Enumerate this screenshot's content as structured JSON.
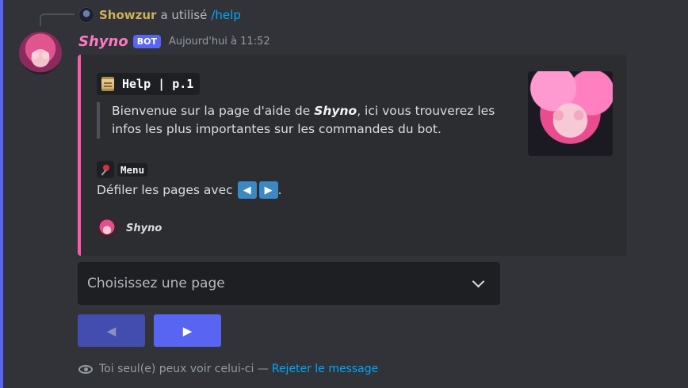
{
  "reply": {
    "username": "Showzur",
    "text": "a utilisé",
    "command": "/help"
  },
  "message": {
    "author": "Shyno",
    "bot_tag": "BOT",
    "timestamp": "Aujourd'hui à 11:52"
  },
  "embed": {
    "accent_color": "#ff5aa8",
    "title_icon": "scroll-icon",
    "title": "Help | p.1",
    "description_prefix": "Bienvenue sur la page d'aide de ",
    "description_bold": "Shyno",
    "description_suffix": ", ici vous trouverez les infos les plus importantes sur les commandes du bot.",
    "field": {
      "icon": "pushpin-icon",
      "name": "Menu",
      "value": "Défiler les pages avec",
      "value_end": ".",
      "arrow_left": "◀",
      "arrow_right": "▶"
    },
    "footer": {
      "text": "Shyno"
    }
  },
  "select": {
    "placeholder": "Choisissez une page"
  },
  "buttons": {
    "prev_label": "◀",
    "next_label": "▶"
  },
  "ephemeral": {
    "notice": "Toi seul(e) peux voir celui-ci —",
    "dismiss": "Rejeter le message"
  },
  "colors": {
    "background": "#313338",
    "embed_bg": "#2b2d31",
    "blurple": "#5865f2",
    "link": "#00a8fc"
  }
}
